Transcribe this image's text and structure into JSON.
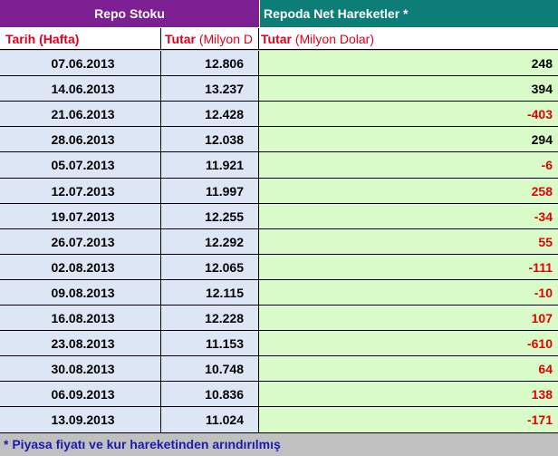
{
  "header": {
    "repo_stock": "Repo Stoku",
    "net_moves": "Repoda Net Hareketler *"
  },
  "subheader": {
    "date_label": "Tarih (Hafta)",
    "amount_label_bold": "Tutar",
    "amount_label_unit": "(Milyon D",
    "net_label_bold": "Tutar",
    "net_label_unit": "(Milyon Dolar)"
  },
  "rows": [
    {
      "date": "07.06.2013",
      "amount": "12.806",
      "net": "248",
      "net_color": "pos"
    },
    {
      "date": "14.06.2013",
      "amount": "13.237",
      "net": "394",
      "net_color": "pos"
    },
    {
      "date": "21.06.2013",
      "amount": "12.428",
      "net": "-403",
      "net_color": "neg"
    },
    {
      "date": "28.06.2013",
      "amount": "12.038",
      "net": "294",
      "net_color": "pos"
    },
    {
      "date": "05.07.2013",
      "amount": "11.921",
      "net": "-6",
      "net_color": "neg"
    },
    {
      "date": "12.07.2013",
      "amount": "11.997",
      "net": "258",
      "net_color": "neg"
    },
    {
      "date": "19.07.2013",
      "amount": "12.255",
      "net": "-34",
      "net_color": "neg"
    },
    {
      "date": "26.07.2013",
      "amount": "12.292",
      "net": "55",
      "net_color": "neg"
    },
    {
      "date": "02.08.2013",
      "amount": "12.065",
      "net": "-111",
      "net_color": "neg"
    },
    {
      "date": "09.08.2013",
      "amount": "12.115",
      "net": "-10",
      "net_color": "neg"
    },
    {
      "date": "16.08.2013",
      "amount": "12.228",
      "net": "107",
      "net_color": "neg"
    },
    {
      "date": "23.08.2013",
      "amount": "11.153",
      "net": "-610",
      "net_color": "neg"
    },
    {
      "date": "30.08.2013",
      "amount": "10.748",
      "net": "64",
      "net_color": "neg"
    },
    {
      "date": "06.09.2013",
      "amount": "10.836",
      "net": "138",
      "net_color": "neg"
    },
    {
      "date": "13.09.2013",
      "amount": "11.024",
      "net": "-171",
      "net_color": "neg"
    }
  ],
  "footnote": "* Piyasa fiyatı ve kur hareketinden arındırılmış",
  "colors": {
    "repo_header": "#7b1f93",
    "net_header": "#0d7d77",
    "row_blue": "#dde6f5",
    "row_green": "#d9fbc8",
    "negative_red": "#e60000",
    "footnote_blue": "#1d1ab3"
  }
}
